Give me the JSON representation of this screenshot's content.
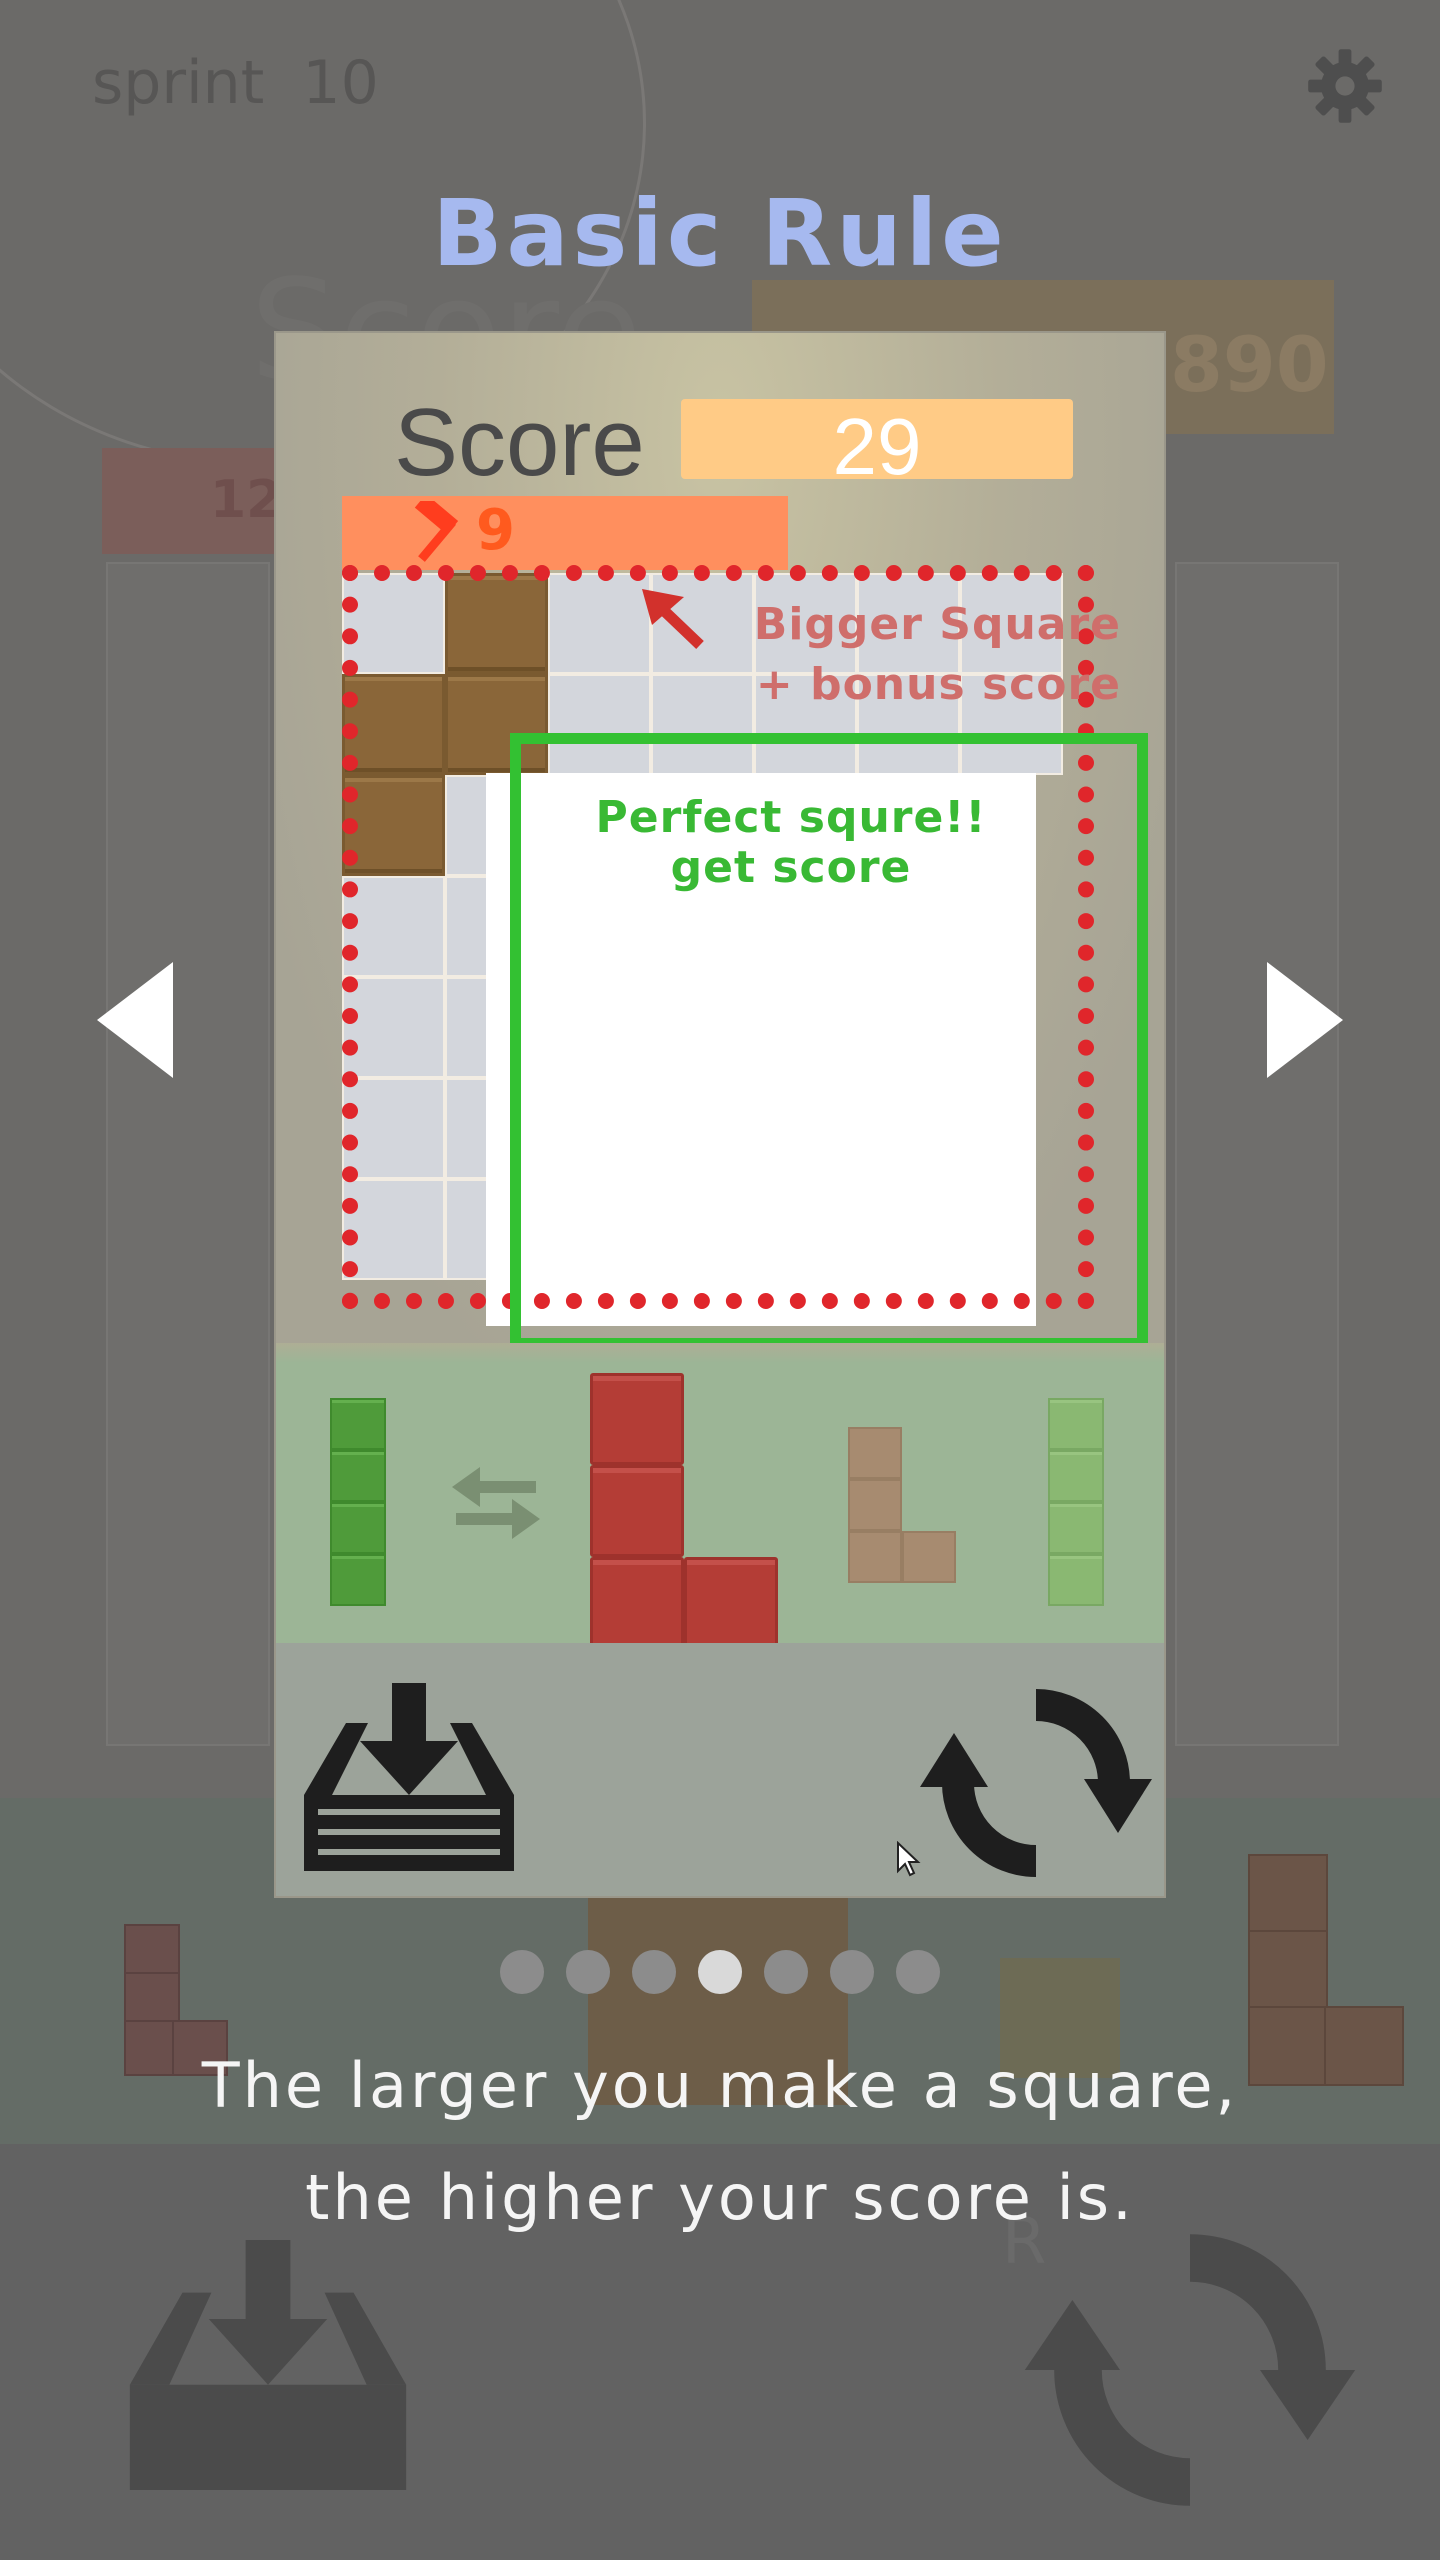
{
  "background": {
    "mode_label": "sprint",
    "mode_value": "10",
    "score_label": "Score",
    "score_value": "890",
    "hammer_count": "12",
    "rotate_label": "R"
  },
  "overlay": {
    "title": "Basic Rule",
    "page_count": 7,
    "current_page": 4,
    "description_line1": "The larger you make a square,",
    "description_line2": "the higher your score is."
  },
  "card": {
    "score_label": "Score",
    "score_value": "29",
    "hammer_value": "9",
    "annotation_red_line1": "Bigger Square",
    "annotation_red_line2": "+ bonus score",
    "annotation_green_line1": "Perfect squre!!",
    "annotation_green_line2": "get score"
  },
  "icons": {
    "settings": "gear-icon",
    "prev": "triangle-left-icon",
    "next": "triangle-right-icon",
    "hold": "inbox-download-icon",
    "rotate": "rotate-icon",
    "swap": "swap-arrows-icon",
    "hammer": "hammer-icon",
    "cursor": "mouse-pointer-icon"
  },
  "colors": {
    "title": "#a6b9ef",
    "dotted_border": "#e0262b",
    "green_border": "#33c132",
    "score_box": "#ffcb86",
    "hammer_box": "#ff8f5e"
  }
}
